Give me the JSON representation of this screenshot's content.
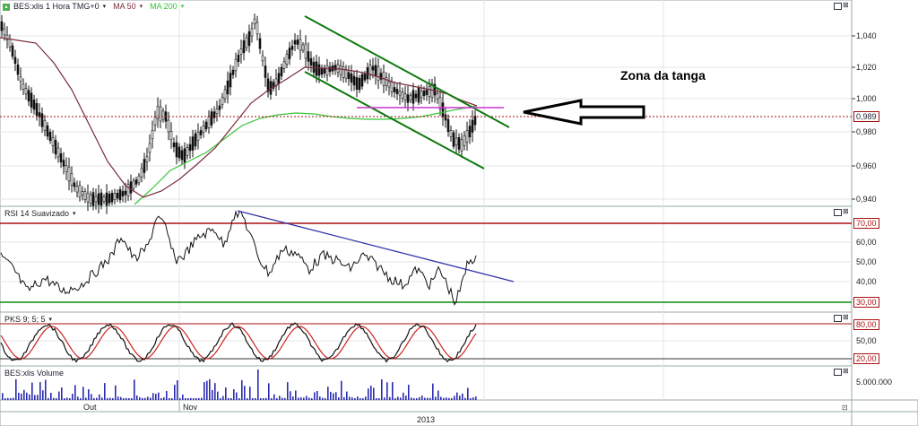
{
  "chart_data": [
    {
      "type": "line",
      "panel": "price",
      "title": "BES:xlis 1 Hora TMG+0",
      "legend": [
        "BES:xlis 1 Hora TMG+0",
        "MA 50",
        "MA 200"
      ],
      "yticks": [
        0.94,
        0.96,
        0.98,
        1.0,
        1.02,
        1.04
      ],
      "ylim": [
        0.932,
        1.058
      ],
      "current_value": "0,989",
      "annotation": "Zona da tanga",
      "colors": {
        "price": "#111111",
        "ma50": "#7a2c3c",
        "ma200": "#35c535",
        "channel": "#0c7a0c",
        "zone": "#cc33cc",
        "current": "#a01010"
      }
    },
    {
      "type": "line",
      "panel": "rsi",
      "title": "RSI 14 Suavizado",
      "yticks": [
        40,
        50,
        60
      ],
      "ylim": [
        22,
        77
      ],
      "levels": [
        "70,00",
        "30,00"
      ],
      "colors": {
        "rsi": "#111111",
        "upper": "#aa1111",
        "lower": "#118811",
        "trend": "#3333aa"
      }
    },
    {
      "type": "line",
      "panel": "stochastic",
      "title": "PKS 9; 5; 5",
      "yticks": [
        50
      ],
      "ylim": [
        10,
        90
      ],
      "levels": [
        "80,00",
        "20,00"
      ],
      "colors": {
        "k": "#111111",
        "d": "#cc2222"
      }
    },
    {
      "type": "bar",
      "panel": "volume",
      "title": "BES:xlis Volume",
      "yticks": [
        "5.000.000"
      ],
      "colors": {
        "bars": "#2a2ab0"
      }
    }
  ],
  "header": {
    "symbol": "BES:xlis 1 Hora TMG+0",
    "ma50": "MA 50",
    "ma200": "MA 200",
    "rsi": "RSI 14 Suavizado",
    "pks": "PKS 9; 5; 5",
    "volume": "BES:xlis Volume"
  },
  "price_axis": [
    "1,040",
    "1,020",
    "1,000",
    "0,980",
    "0,960",
    "0,940"
  ],
  "current_price": "0,989",
  "rsi_axis": {
    "upper": "70,00",
    "v60": "60,00",
    "v50": "50,00",
    "v40": "40,00",
    "lower": "30,00"
  },
  "pks_axis": {
    "upper": "80,00",
    "v50": "50,00",
    "lower": "20,00"
  },
  "volume_axis": "5.000.000",
  "time_axis": {
    "month1": "Out",
    "month2": "Nov",
    "year": "2013"
  },
  "annotation": "Zona da tanga"
}
